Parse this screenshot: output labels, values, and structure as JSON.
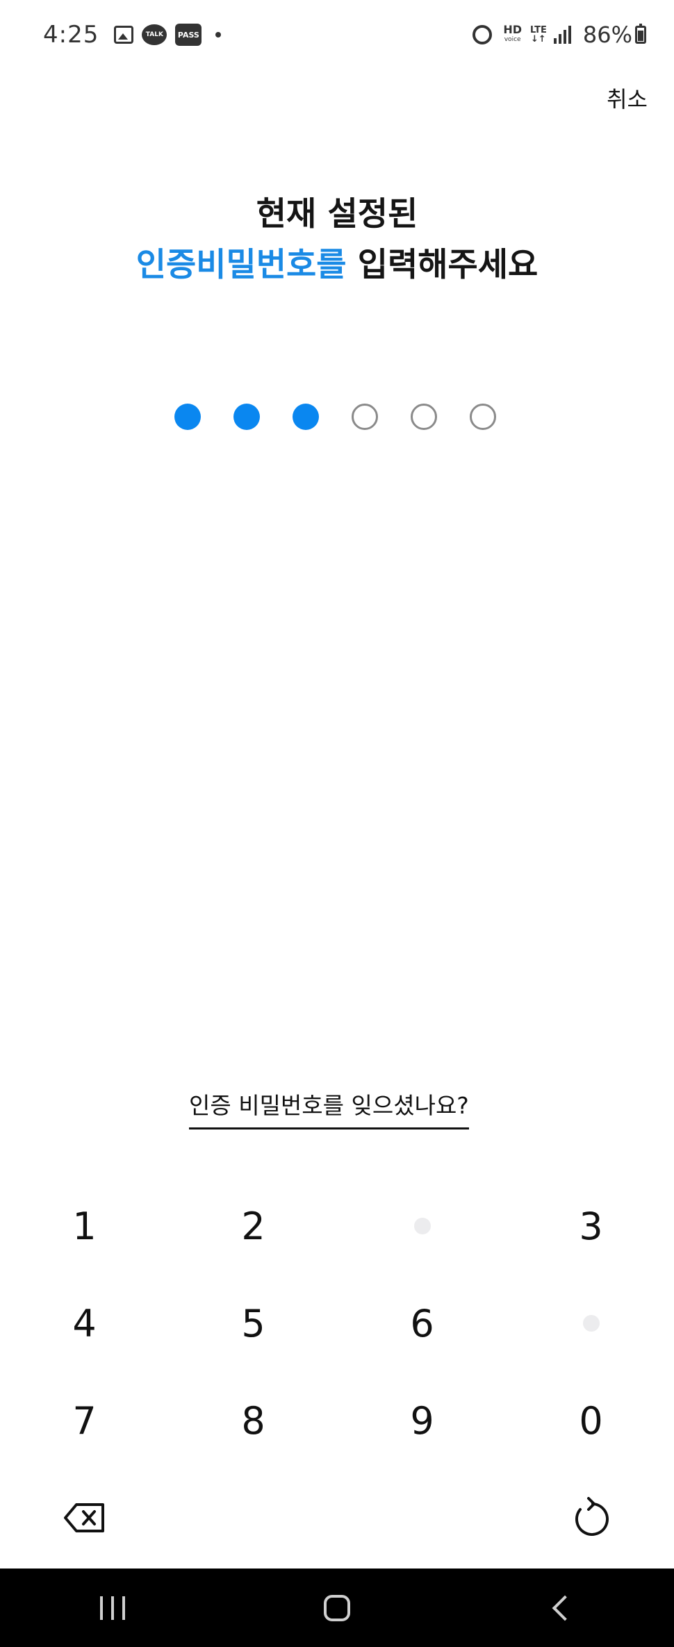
{
  "status_bar": {
    "time": "4:25",
    "notification_icons": [
      "gallery-icon",
      "kakaotalk-icon",
      "pass-icon",
      "more-dot-icon"
    ],
    "talk_label": "TALK",
    "pass_label": "PASS",
    "hd_label": "HD",
    "voice_label": "voice",
    "lte_label": "LTE",
    "battery": "86%"
  },
  "header": {
    "cancel_label": "취소"
  },
  "title": {
    "line1": "현재 설정된",
    "line2_accent": "인증비밀번호를",
    "line2_rest": " 입력해주세요",
    "accent_color": "#1a8ae5"
  },
  "pin": {
    "length": 6,
    "entered": 3,
    "filled_color": "#0a87f0"
  },
  "forgot_link": "인증 비밀번호를 잊으셨나요?",
  "keypad": {
    "row1": [
      "1",
      "2",
      "",
      "3"
    ],
    "row2": [
      "4",
      "5",
      "6",
      ""
    ],
    "row3": [
      "7",
      "8",
      "9",
      "0"
    ],
    "bottom_left": "backspace-icon",
    "bottom_right": "refresh-icon"
  },
  "nav_bar": {
    "buttons": [
      "recents-icon",
      "home-icon",
      "back-icon"
    ]
  }
}
